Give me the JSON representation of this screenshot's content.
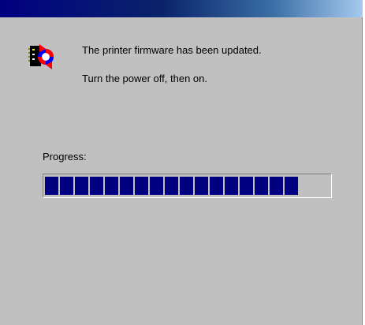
{
  "dialog": {
    "message_line1": "The printer firmware has been updated.",
    "message_line2": "Turn the power off, then on.",
    "icon": "firmware-update-icon"
  },
  "progress": {
    "label": "Progress:",
    "fraction": 0.93
  },
  "colors": {
    "window_bg": "#c0c0c0",
    "progress_fill": "#000080",
    "title_gradient_start": "#000080",
    "title_gradient_end": "#a6caf0"
  }
}
